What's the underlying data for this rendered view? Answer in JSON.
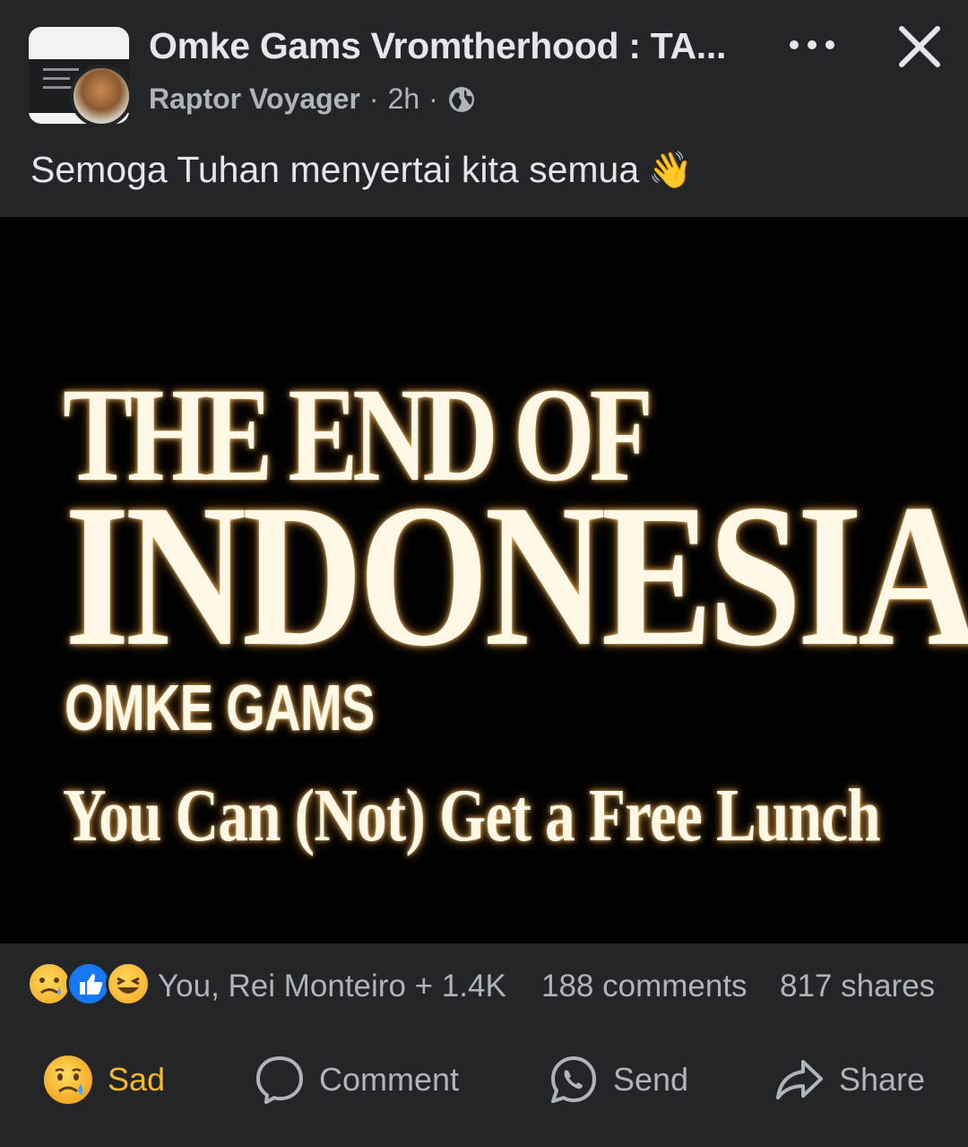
{
  "header": {
    "group_name": "Omke Gams Vromtherhood : TA...",
    "author": "Raptor Voyager",
    "time": "2h",
    "separator": "·"
  },
  "post": {
    "text": "Semoga Tuhan menyertai kita semua",
    "emoji": "👋"
  },
  "media": {
    "line1": "THE END OF",
    "line2": "INDONESIA",
    "line3": "OMKE GAMS",
    "line4": "You Can (Not) Get a Free Lunch"
  },
  "stats": {
    "reactors": "You, Rei Monteiro + 1.4K",
    "comments": "188 comments",
    "shares": "817 shares",
    "reaction_icons": [
      "sad-icon",
      "like-icon",
      "haha-icon"
    ]
  },
  "actions": {
    "sad": "Sad",
    "comment": "Comment",
    "send": "Send",
    "share": "Share"
  },
  "colors": {
    "background": "#242526",
    "text": "#e4e6eb",
    "secondary": "#b0b3b8",
    "sad_accent": "#f7b928",
    "like_blue": "#1877f2"
  }
}
